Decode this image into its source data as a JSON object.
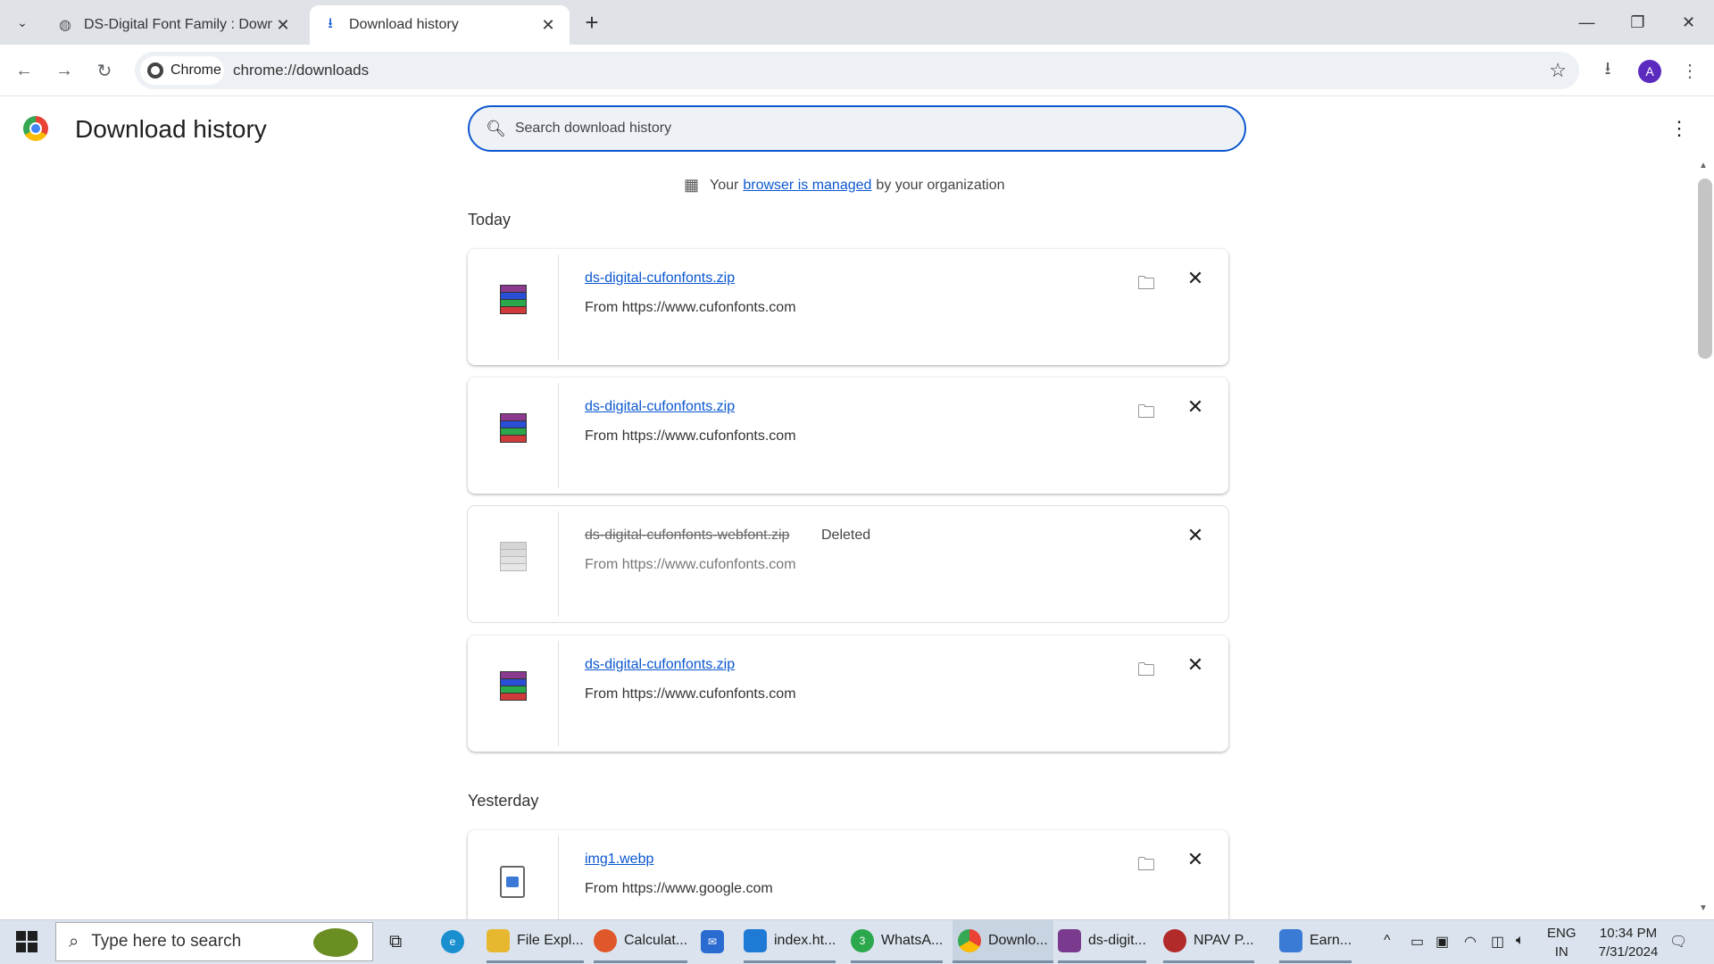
{
  "tabs": [
    {
      "title": "DS-Digital Font Family : Downlo",
      "icon": "globe-icon"
    },
    {
      "title": "Download history",
      "icon": "download-icon"
    }
  ],
  "omnibox": {
    "chip": "Chrome",
    "url": "chrome://downloads"
  },
  "profile_initial": "A",
  "page": {
    "title": "Download history",
    "search_placeholder": "Search download history",
    "managed": {
      "prefix": "Your",
      "link": "browser is managed",
      "suffix": "by your organization"
    }
  },
  "sections": [
    {
      "label": "Today"
    },
    {
      "label": "Yesterday"
    }
  ],
  "downloads": [
    {
      "name": "ds-digital-cufonfonts.zip",
      "from": "From https://www.cufonfonts.com",
      "status": "",
      "deleted": false,
      "type": "zip"
    },
    {
      "name": "ds-digital-cufonfonts.zip",
      "from": "From https://www.cufonfonts.com",
      "status": "",
      "deleted": false,
      "type": "zip"
    },
    {
      "name": "ds-digital-cufonfonts-webfont.zip",
      "from": "From https://www.cufonfonts.com",
      "status": "Deleted",
      "deleted": true,
      "type": "zip"
    },
    {
      "name": "ds-digital-cufonfonts.zip",
      "from": "From https://www.cufonfonts.com",
      "status": "",
      "deleted": false,
      "type": "zip"
    },
    {
      "name": "img1.webp",
      "from": "From https://www.google.com",
      "status": "",
      "deleted": false,
      "type": "image"
    }
  ],
  "taskbar": {
    "search_placeholder": "Type here to search",
    "apps": [
      {
        "label": "File Expl...",
        "icon": "folder-icon",
        "color": "#e8b730"
      },
      {
        "label": "Calculat...",
        "icon": "firefox-icon",
        "color": "#e0582a"
      },
      {
        "label": "index.ht...",
        "icon": "vscode-icon",
        "color": "#1f7ad6"
      },
      {
        "label": "WhatsA...",
        "icon": "whatsapp-icon",
        "color": "#2aa84b"
      },
      {
        "label": "Downlo...",
        "icon": "chrome-icon",
        "color": "#db4437"
      },
      {
        "label": "ds-digit...",
        "icon": "winrar-icon",
        "color": "#7a3b8f"
      },
      {
        "label": "NPAV P...",
        "icon": "npav-icon",
        "color": "#b22a2a"
      },
      {
        "label": "Earn...",
        "icon": "document-icon",
        "color": "#3a7bd5"
      }
    ],
    "whatsapp_badge": "3",
    "lang": [
      "ENG",
      "IN"
    ],
    "time": "10:34 PM",
    "date": "7/31/2024"
  }
}
